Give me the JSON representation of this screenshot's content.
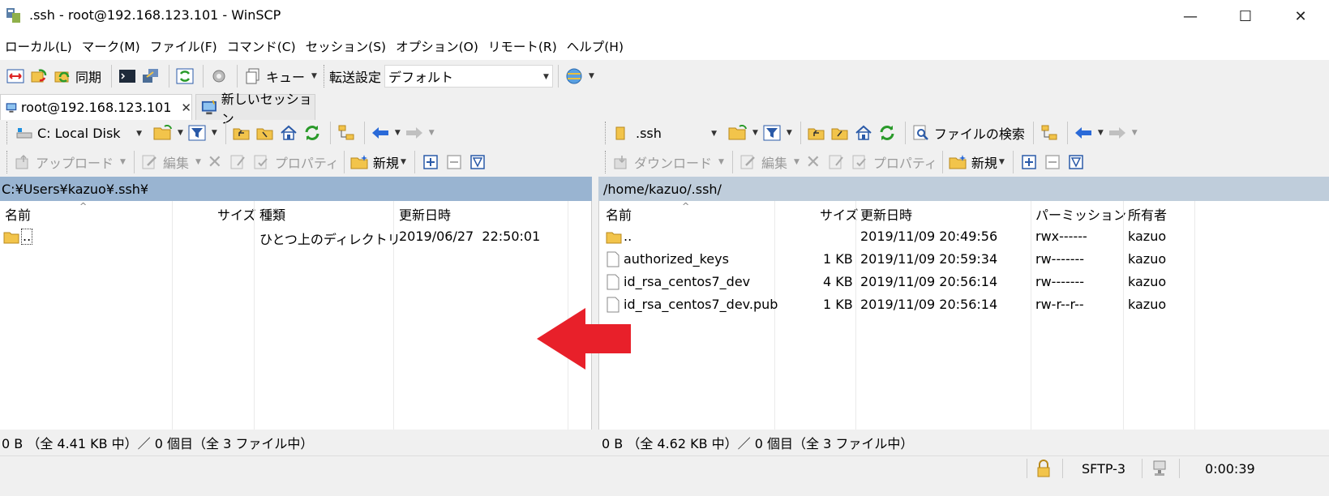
{
  "window": {
    "title": ".ssh - root@192.168.123.101 - WinSCP",
    "minimize": "—",
    "maximize": "☐",
    "close": "✕"
  },
  "menu": [
    "ローカル(L)",
    "マーク(M)",
    "ファイル(F)",
    "コマンド(C)",
    "セッション(S)",
    "オプション(O)",
    "リモート(R)",
    "ヘルプ(H)"
  ],
  "toolbar": {
    "sync_label": "同期",
    "queue_label": "キュー",
    "transfer_label": "転送設定",
    "transfer_value": "デフォルト"
  },
  "tabs": {
    "active": "root@192.168.123.101",
    "new_session": "新しいセッション"
  },
  "local": {
    "drive": "C: Local Disk",
    "upload": "アップロード",
    "edit": "編集",
    "properties": "プロパティ",
    "new": "新規",
    "path": "C:¥Users¥kazuo¥.ssh¥",
    "columns": [
      "名前",
      "サイズ",
      "種類",
      "更新日時"
    ],
    "rows": [
      {
        "name": "..",
        "size": "",
        "type": "ひとつ上のディレクトリ",
        "modified": "2019/06/27  22:50:01"
      }
    ],
    "status": "0 B （全 4.41 KB 中）／ 0 個目（全 3 ファイル中）"
  },
  "remote": {
    "folder": ".ssh",
    "find_files": "ファイルの検索",
    "download": "ダウンロード",
    "edit": "編集",
    "properties": "プロパティ",
    "new": "新規",
    "path": "/home/kazuo/.ssh/",
    "columns": [
      "名前",
      "サイズ",
      "更新日時",
      "パーミッション",
      "所有者"
    ],
    "rows": [
      {
        "name": "..",
        "size": "",
        "modified": "2019/11/09 20:49:56",
        "perm": "rwx------",
        "owner": "kazuo"
      },
      {
        "name": "authorized_keys",
        "size": "1 KB",
        "modified": "2019/11/09 20:59:34",
        "perm": "rw-------",
        "owner": "kazuo"
      },
      {
        "name": "id_rsa_centos7_dev",
        "size": "4 KB",
        "modified": "2019/11/09 20:56:14",
        "perm": "rw-------",
        "owner": "kazuo"
      },
      {
        "name": "id_rsa_centos7_dev.pub",
        "size": "1 KB",
        "modified": "2019/11/09 20:56:14",
        "perm": "rw-r--r--",
        "owner": "kazuo"
      }
    ],
    "status": "0 B （全 4.62 KB 中）／ 0 個目（全 3 ファイル中）"
  },
  "statusbar": {
    "protocol": "SFTP-3",
    "elapsed": "0:00:39"
  },
  "colors": {
    "path_active": "#99b4d1",
    "path_inactive": "#bfcddb",
    "arrow": "#e8202a"
  }
}
